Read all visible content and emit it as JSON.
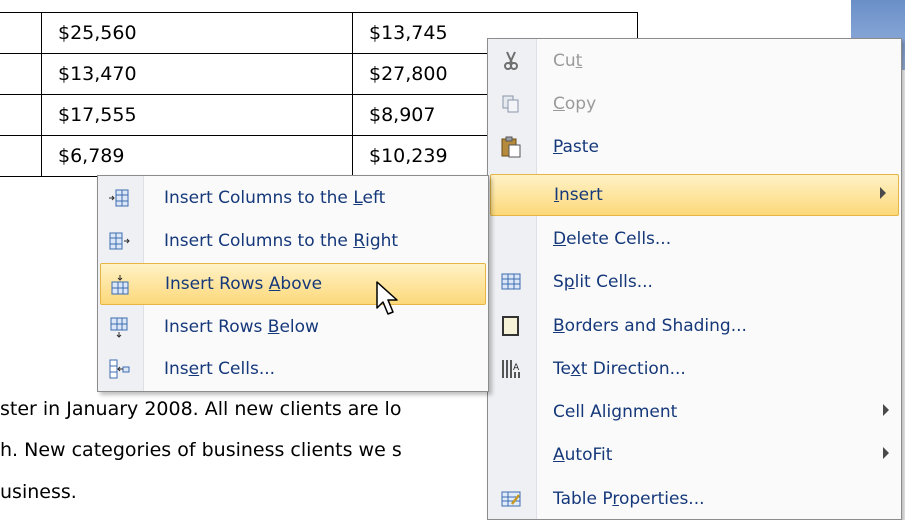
{
  "table": {
    "rows": [
      {
        "a": "$25,560",
        "b": "$13,745"
      },
      {
        "a": "$13,470",
        "b": "$27,800"
      },
      {
        "a": "$17,555",
        "b": "$8,907"
      },
      {
        "a": "$6,789",
        "b": "$10,239"
      }
    ]
  },
  "paragraph": {
    "line1": "ster in January 2008.  All new clients are lo",
    "line2": "h. New categories of business clients we s",
    "line3": "usiness."
  },
  "context_menu": {
    "items": [
      {
        "pre": "Cu",
        "ul": "t",
        "post": "",
        "icon": "scissors-icon"
      },
      {
        "pre": "",
        "ul": "C",
        "post": "opy",
        "icon": "copy-icon"
      },
      {
        "pre": "",
        "ul": "P",
        "post": "aste",
        "icon": "paste-icon"
      },
      {
        "pre": "",
        "ul": "I",
        "post": "nsert",
        "icon": ""
      },
      {
        "pre": "",
        "ul": "D",
        "post": "elete Cells...",
        "icon": ""
      },
      {
        "pre": "S",
        "ul": "p",
        "post": "lit Cells...",
        "icon": "split-cells-icon"
      },
      {
        "pre": "",
        "ul": "B",
        "post": "orders and Shading...",
        "icon": "borders-icon"
      },
      {
        "pre": "Te",
        "ul": "x",
        "post": "t Direction...",
        "icon": "text-direction-icon"
      },
      {
        "pre": "Cell Ali",
        "ul": "g",
        "post": "nment",
        "icon": ""
      },
      {
        "pre": "",
        "ul": "A",
        "post": "utoFit",
        "icon": ""
      },
      {
        "pre": "Table P",
        "ul": "r",
        "post": "operties...",
        "icon": "table-properties-icon"
      }
    ]
  },
  "insert_submenu": {
    "items": [
      {
        "pre": "Insert Columns to the ",
        "ul": "L",
        "post": "eft",
        "icon": "insert-columns-left-icon"
      },
      {
        "pre": "Insert Columns to the ",
        "ul": "R",
        "post": "ight",
        "icon": "insert-columns-right-icon"
      },
      {
        "pre": "Insert Rows ",
        "ul": "A",
        "post": "bove",
        "icon": "insert-rows-above-icon"
      },
      {
        "pre": "Insert Rows ",
        "ul": "B",
        "post": "elow",
        "icon": "insert-rows-below-icon"
      },
      {
        "pre": "Ins",
        "ul": "e",
        "post": "rt Cells...",
        "icon": "insert-cells-icon"
      }
    ]
  },
  "colors": {
    "highlight_top": "#fff2c6",
    "highlight_bottom": "#fcd87a",
    "menu_text": "#15387a",
    "disabled_text": "#9a9a9a"
  }
}
